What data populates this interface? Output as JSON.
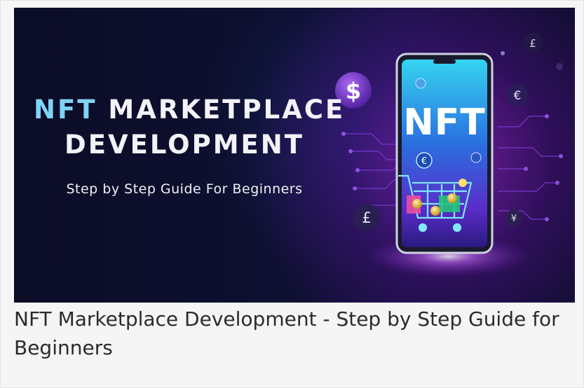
{
  "banner": {
    "headline_prefix": "NFT",
    "headline_rest": "MARKETPLACE",
    "headline_line2": "DEVELOPMENT",
    "subheadline": "Step by Step Guide For Beginners",
    "phone_label": "NFT",
    "icons": [
      "dollar-coin-icon",
      "euro-coin-icon",
      "pound-coin-icon",
      "yen-coin-icon",
      "bitcoin-coin-icon",
      "shopping-cart-icon"
    ],
    "colors": {
      "background": "#0d1030",
      "accent_cyan": "#7fd3f5",
      "accent_purple": "#b43cf0"
    }
  },
  "caption": {
    "text": "NFT Marketplace Development - Step by Step Guide for Beginners"
  }
}
